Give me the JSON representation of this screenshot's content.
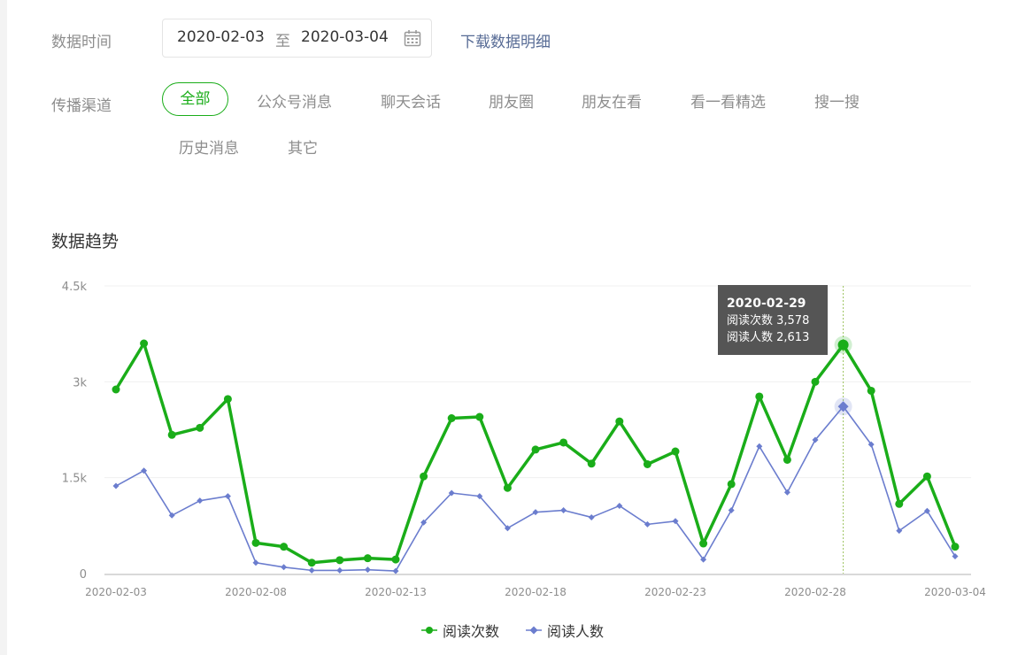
{
  "filters": {
    "time_label": "数据时间",
    "date_start": "2020-02-03",
    "date_sep": "至",
    "date_end": "2020-03-04",
    "download_label": "下载数据明细",
    "channel_label": "传播渠道",
    "channels": [
      "全部",
      "公众号消息",
      "聊天会话",
      "朋友圈",
      "朋友在看",
      "看一看精选",
      "搜一搜",
      "历史消息",
      "其它"
    ],
    "active_channel": "全部"
  },
  "section_title": "数据趋势",
  "colors": {
    "reads": "#1aad19",
    "readers": "#6b7dce",
    "active": "#1aad19",
    "link": "#576b95"
  },
  "icons": {
    "calendar": "calendar-icon"
  },
  "chart_data": {
    "type": "line",
    "x": [
      "2020-02-03",
      "2020-02-04",
      "2020-02-05",
      "2020-02-06",
      "2020-02-07",
      "2020-02-08",
      "2020-02-09",
      "2020-02-10",
      "2020-02-11",
      "2020-02-12",
      "2020-02-13",
      "2020-02-14",
      "2020-02-15",
      "2020-02-16",
      "2020-02-17",
      "2020-02-18",
      "2020-02-19",
      "2020-02-20",
      "2020-02-21",
      "2020-02-22",
      "2020-02-23",
      "2020-02-24",
      "2020-02-25",
      "2020-02-26",
      "2020-02-27",
      "2020-02-28",
      "2020-02-29",
      "2020-03-01",
      "2020-03-02",
      "2020-03-03",
      "2020-03-04"
    ],
    "x_tick_labels": [
      "2020-02-03",
      "2020-02-08",
      "2020-02-13",
      "2020-02-18",
      "2020-02-23",
      "2020-02-28",
      "2020-03-04"
    ],
    "y_ticks": [
      0,
      1500,
      3000,
      4500
    ],
    "y_tick_labels": [
      "0",
      "1.5k",
      "3k",
      "4.5k"
    ],
    "ylim": [
      0,
      4500
    ],
    "grid": true,
    "legend_position": "bottom-center",
    "series": [
      {
        "name": "阅读次数",
        "marker": "circle",
        "values": [
          2880,
          3600,
          2170,
          2280,
          2730,
          480,
          420,
          170,
          210,
          240,
          220,
          1520,
          2430,
          2450,
          1340,
          1940,
          2050,
          1720,
          2380,
          1710,
          1910,
          470,
          1400,
          2770,
          1780,
          3000,
          3578,
          2860,
          1090,
          1520,
          420
        ]
      },
      {
        "name": "阅读人数",
        "marker": "diamond",
        "values": [
          1370,
          1610,
          910,
          1140,
          1210,
          170,
          100,
          50,
          50,
          60,
          40,
          800,
          1260,
          1210,
          710,
          960,
          990,
          880,
          1060,
          770,
          820,
          220,
          990,
          1990,
          1270,
          2090,
          2613,
          2020,
          670,
          980,
          270
        ]
      }
    ],
    "tooltip": {
      "date": "2020-02-29",
      "lines": [
        "阅读次数 3,578",
        "阅读人数 2,613"
      ]
    }
  }
}
